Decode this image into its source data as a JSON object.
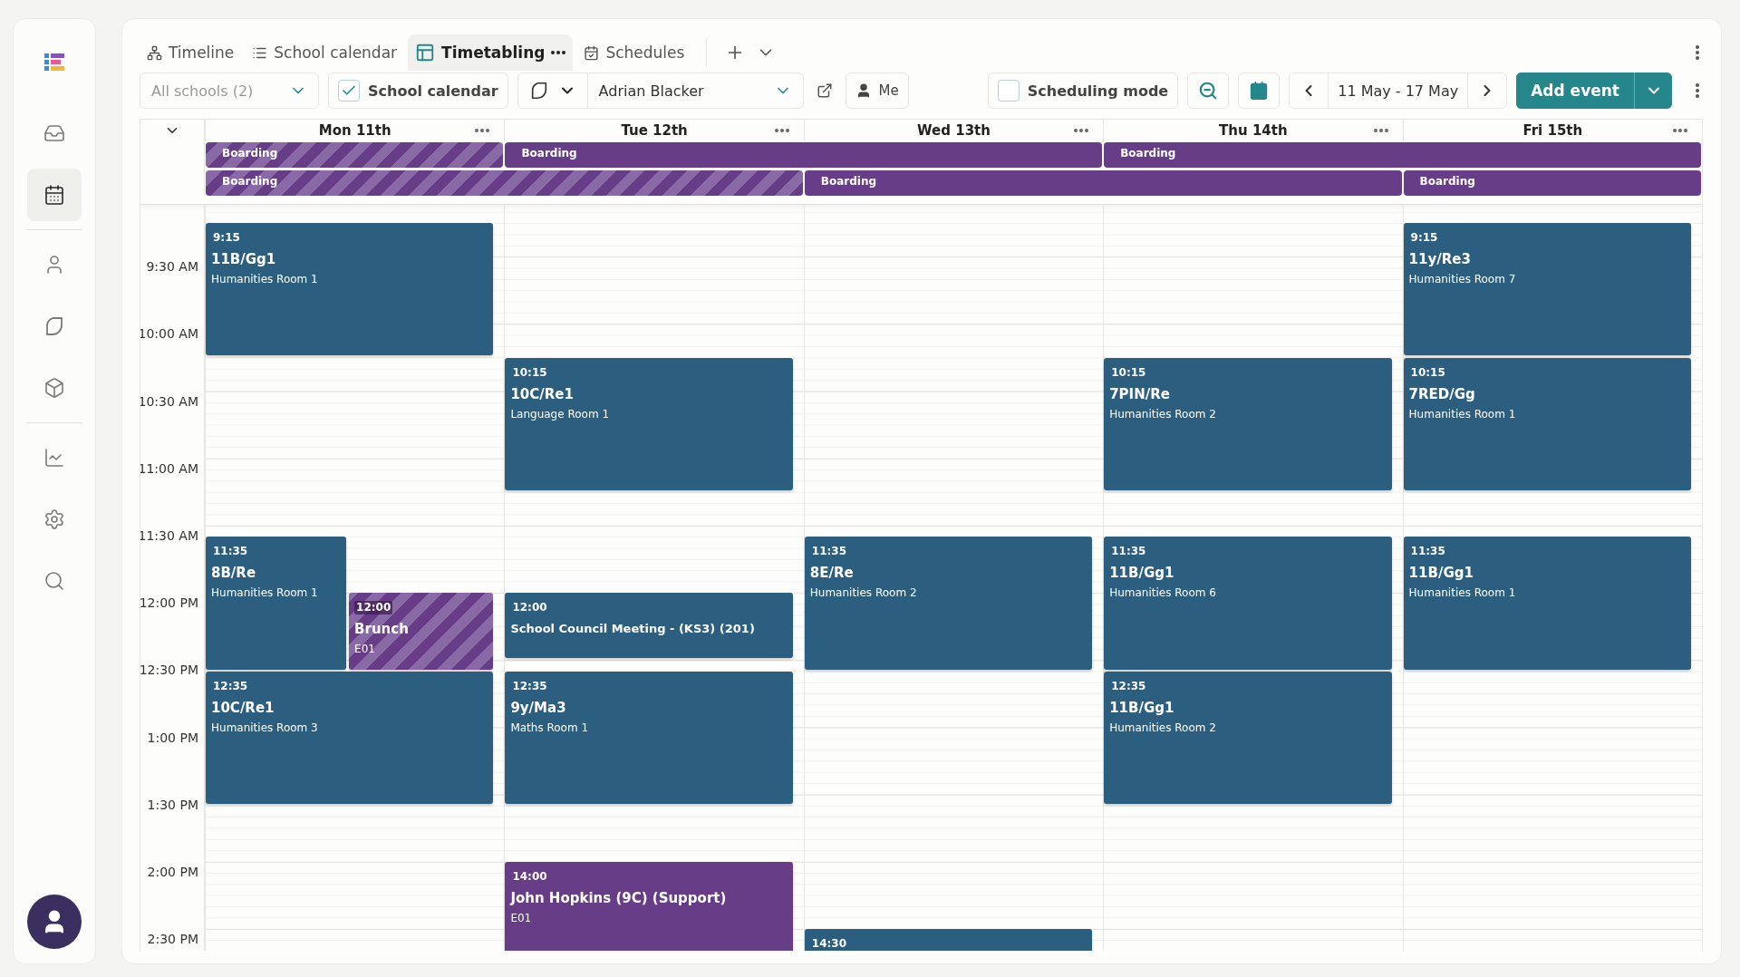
{
  "sidebar": {
    "items": [
      {
        "selected": false
      },
      {
        "selected": true
      },
      {
        "selected": false
      },
      {
        "selected": false
      },
      {
        "selected": false
      },
      {
        "selected": false
      },
      {
        "selected": false
      },
      {
        "selected": false
      }
    ]
  },
  "tabs": [
    {
      "label": "Timeline",
      "selected": false
    },
    {
      "label": "School calendar",
      "selected": false
    },
    {
      "label": "Timetabling",
      "selected": true
    },
    {
      "label": "Schedules",
      "selected": false
    }
  ],
  "toolbar": {
    "schools_filter": {
      "value": "All schools (2)"
    },
    "school_calendar": {
      "label": "School calendar",
      "checked": true
    },
    "person_select": {
      "value": "Adrian Blacker"
    },
    "me_button": {
      "label": "Me"
    },
    "scheduling_mode": {
      "label": "Scheduling mode",
      "checked": false
    },
    "date_range": "11 May - 17 May",
    "add_event": "Add event"
  },
  "all_day_rows": [
    {
      "cells": [
        {
          "label": "Boarding",
          "striped": true,
          "joins_previous": false
        },
        {
          "label": "Boarding",
          "striped": false,
          "joins_previous": false
        },
        {
          "joins_previous": true
        },
        {
          "label": "Boarding",
          "striped": false,
          "joins_previous": false
        },
        {
          "joins_previous": true
        }
      ]
    },
    {
      "cells": [
        {
          "label": "Boarding",
          "striped": true,
          "joins_previous": false
        },
        {
          "joins_previous": true
        },
        {
          "label": "Boarding",
          "striped": false,
          "joins_previous": false
        },
        {
          "joins_previous": true
        },
        {
          "label": "Boarding",
          "striped": false,
          "joins_previous": false
        }
      ]
    }
  ],
  "time_labels": [
    "9:30 AM",
    "10:00 AM",
    "10:30 AM",
    "11:00 AM",
    "11:30 AM",
    "12:00 PM",
    "12:30 PM",
    "1:00 PM",
    "1:30 PM",
    "2:00 PM",
    "2:30 PM"
  ],
  "days": [
    {
      "label": "Mon 11th",
      "events": [
        {
          "time": "9:15",
          "title": "11B/Gg1",
          "room": "Humanities Room 1",
          "kind": "lesson",
          "striped": false
        },
        {
          "time": "11:35",
          "title": "8B/Re",
          "room": "Humanities Room 1",
          "kind": "lesson",
          "striped": false
        },
        {
          "time": "12:00",
          "title": "Brunch",
          "room": "E01",
          "kind": "break",
          "striped": true
        },
        {
          "time": "12:35",
          "title": "10C/Re1",
          "room": "Humanities Room 3",
          "kind": "lesson",
          "striped": false
        }
      ]
    },
    {
      "label": "Tue 12th",
      "events": [
        {
          "time": "10:15",
          "title": "10C/Re1",
          "room": "Language Room 1",
          "kind": "lesson",
          "striped": false
        },
        {
          "time": "12:00",
          "title": "School Council Meeting - (KS3) (201)",
          "kind": "meeting",
          "striped": false
        },
        {
          "time": "12:35",
          "title": "9y/Ma3",
          "room": "Maths Room 1",
          "kind": "lesson",
          "striped": false
        },
        {
          "time": "14:00",
          "title": "John Hopkins (9C) (Support)",
          "room": "E01",
          "kind": "support",
          "striped": false
        }
      ]
    },
    {
      "label": "Wed 13th",
      "events": [
        {
          "time": "11:35",
          "title": "8E/Re",
          "room": "Humanities Room 2",
          "kind": "lesson",
          "striped": false
        },
        {
          "time": "14:30",
          "kind": "lesson",
          "striped": false
        }
      ]
    },
    {
      "label": "Thu 14th",
      "events": [
        {
          "time": "10:15",
          "title": "7PIN/Re",
          "room": "Humanities Room 2",
          "kind": "lesson",
          "striped": false
        },
        {
          "time": "11:35",
          "title": "11B/Gg1",
          "room": "Humanities Room 6",
          "kind": "lesson",
          "striped": false
        },
        {
          "time": "12:35",
          "title": "11B/Gg1",
          "room": "Humanities Room 2",
          "kind": "lesson",
          "striped": false
        }
      ]
    },
    {
      "label": "Fri 15th",
      "events": [
        {
          "time": "9:15",
          "title": "11y/Re3",
          "room": "Humanities Room 7",
          "kind": "lesson",
          "striped": false
        },
        {
          "time": "10:15",
          "title": "7RED/Gg",
          "room": "Humanities Room 1",
          "kind": "lesson",
          "striped": false
        },
        {
          "time": "11:35",
          "title": "11B/Gg1",
          "room": "Humanities Room 1",
          "kind": "lesson",
          "striped": false
        }
      ]
    }
  ]
}
